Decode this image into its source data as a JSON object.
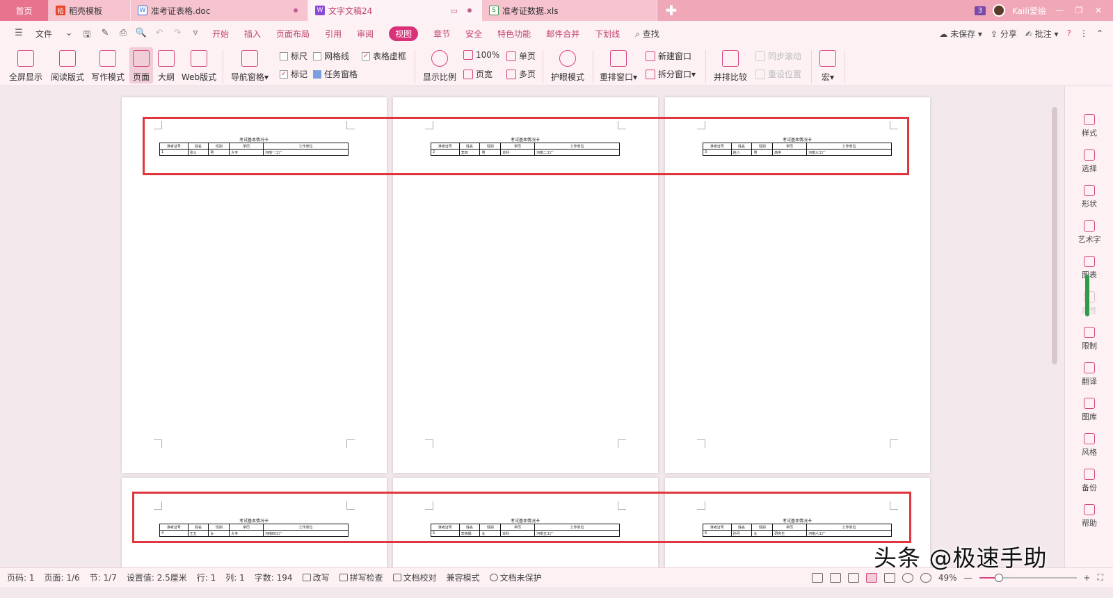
{
  "tabs": {
    "home": "首页",
    "t1": "稻壳模板",
    "t2": "准考证表格.doc",
    "t3": "文字文稿24",
    "t4": "准考证数据.xls",
    "badge": "3",
    "user": "Kaili爱绘"
  },
  "menu": {
    "file": "文件",
    "items": [
      "开始",
      "插入",
      "页面布局",
      "引用",
      "审阅",
      "视图",
      "章节",
      "安全",
      "特色功能",
      "邮件合并",
      "下划线"
    ],
    "active": "视图",
    "search": "查找",
    "unsaved": "未保存",
    "share": "分享",
    "annotate": "批注"
  },
  "ribbon": {
    "fullscreen": "全屏显示",
    "read_mode": "阅读版式",
    "write_mode": "写作模式",
    "page": "页面",
    "outline": "大纲",
    "web": "Web版式",
    "nav_pane": "导航窗格",
    "ruler": "标尺",
    "gridlines": "网格线",
    "table_lines": "表格虚框",
    "marks": "标记",
    "task_pane": "任务窗格",
    "zoom": "显示比例",
    "zoom100": "100%",
    "page_width": "页宽",
    "single_page": "单页",
    "multi_page": "多页",
    "eye_mode": "护眼模式",
    "rearrange": "重排窗口",
    "new_window": "新建窗口",
    "split_window": "拆分窗口",
    "side_by_side": "并排比较",
    "sync_scroll": "同步滚动",
    "reset_pos": "重设位置",
    "macro": "宏"
  },
  "doc": {
    "title": "考试基本情况卡",
    "headers": [
      "准考证号",
      "姓名",
      "性别",
      "学历",
      "工作单位"
    ],
    "rows": [
      [
        "1",
        "张三",
        "男",
        "大专",
        "河南一工厂"
      ],
      [
        "2",
        "李四",
        "男",
        "本科",
        "河南二工厂"
      ],
      [
        "3",
        "赵六",
        "男",
        "高中",
        "河南三工厂"
      ],
      [
        "4",
        "王五",
        "女",
        "大专",
        "河南四工厂"
      ],
      [
        "5",
        "李晓娟",
        "女",
        "本科",
        "河南五工厂"
      ],
      [
        "6",
        "孙丹",
        "女",
        "研究生",
        "河南六工厂"
      ]
    ]
  },
  "sidebar": [
    "样式",
    "选择",
    "形状",
    "艺术字",
    "图表",
    "属性",
    "限制",
    "翻译",
    "图库",
    "风格",
    "备份",
    "帮助"
  ],
  "status": {
    "page_code": "页码: 1",
    "pages": "页面: 1/6",
    "section": "节: 1/7",
    "setting": "设置值: 2.5厘米",
    "row": "行: 1",
    "col": "列: 1",
    "words": "字数: 194",
    "revise": "改写",
    "spell": "拼写检查",
    "proof": "文档校对",
    "compat": "兼容模式",
    "protect": "文档未保护",
    "zoom": "49%",
    "zoom_fraction": 0.2
  },
  "watermark": "头条 @极速手助",
  "colors": {
    "accent": "#d9327a",
    "highlight_box": "#e0363d",
    "tabbar": "#f0a7b8"
  }
}
